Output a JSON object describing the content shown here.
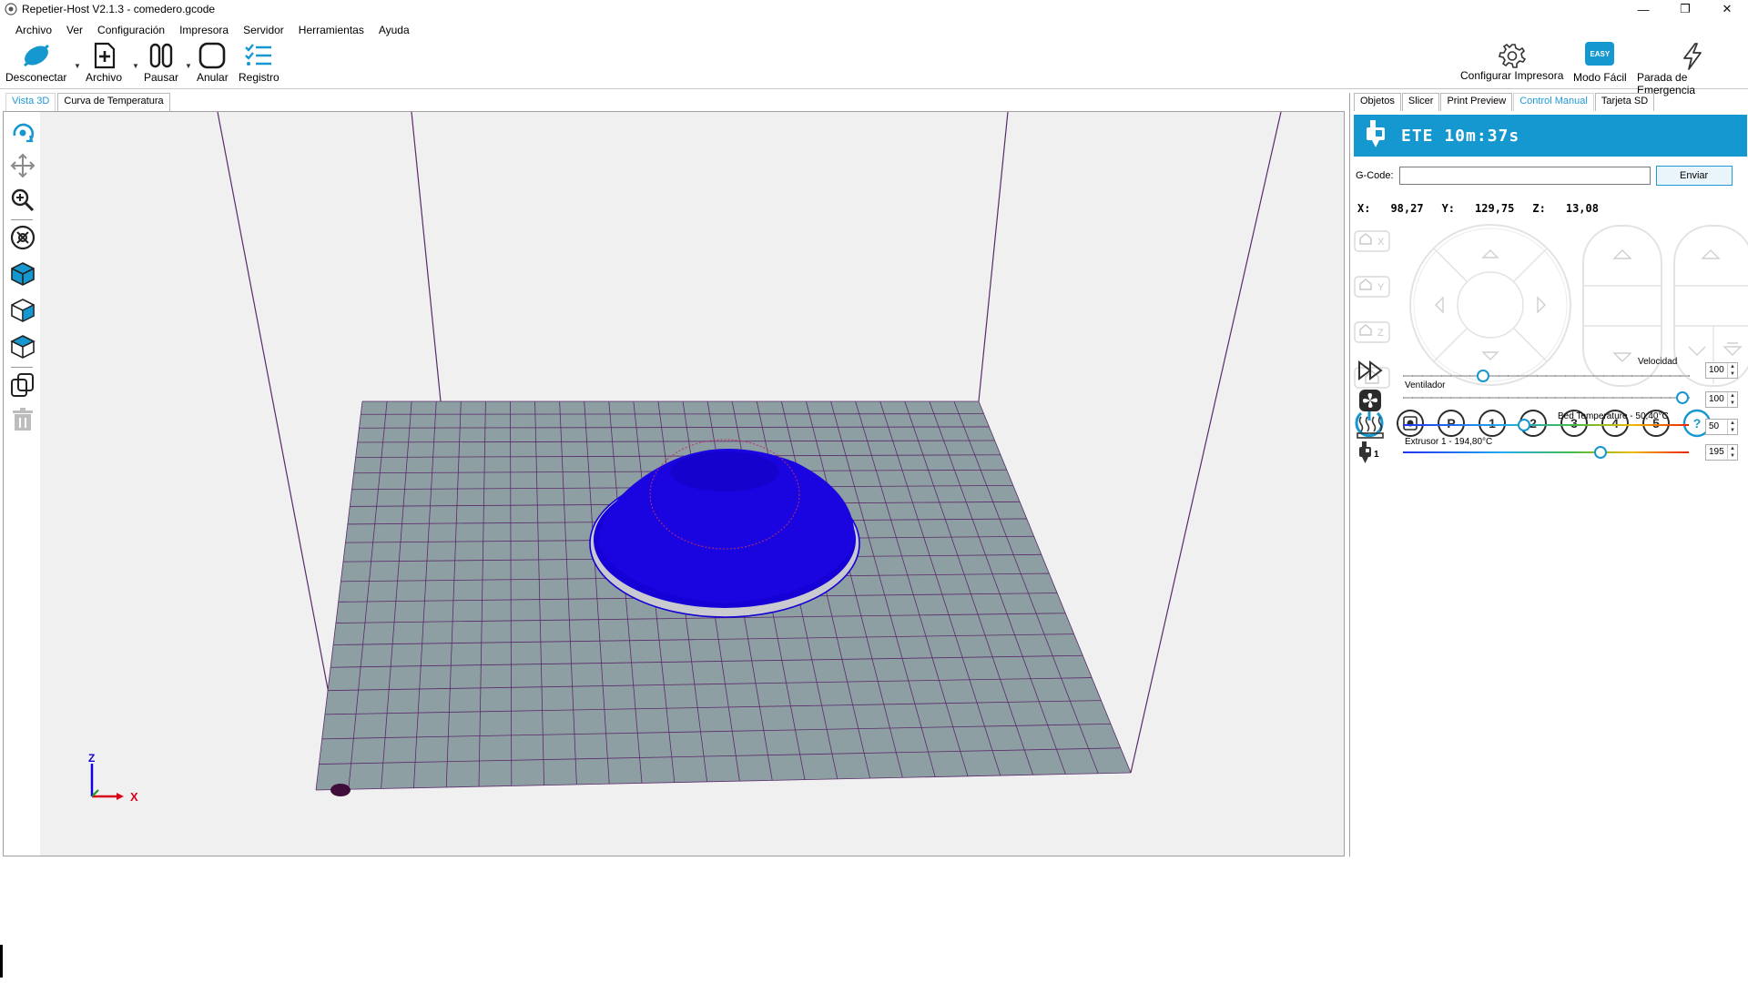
{
  "window": {
    "title": "Repetier-Host V2.1.3 - comedero.gcode",
    "controls": [
      "—",
      "❐",
      "✕"
    ]
  },
  "menu": [
    "Archivo",
    "Ver",
    "Configuración",
    "Impresora",
    "Servidor",
    "Herramientas",
    "Ayuda"
  ],
  "toolbar": {
    "disconnect": "Desconectar",
    "file": "Archivo",
    "pause": "Pausar",
    "cancel": "Anular",
    "log": "Registro",
    "configure_printer": "Configurar Impresora",
    "easy_mode": "Modo Fácil",
    "easy_badge": "EASY",
    "emergency_stop": "Parada de Emergencia"
  },
  "left_tabs": [
    "Vista 3D",
    "Curva de Temperatura"
  ],
  "left_tabs_active": 0,
  "sidetools": [
    "rotate-icon",
    "move-icon",
    "zoom-icon",
    "fit-view-icon",
    "iso-view-icon",
    "front-view-icon",
    "top-view-icon",
    "copy-object-icon",
    "trash-icon"
  ],
  "axes": {
    "z": "Z",
    "x": "X"
  },
  "right_tabs": [
    "Objetos",
    "Slicer",
    "Print Preview",
    "Control Manual",
    "Tarjeta SD"
  ],
  "right_tabs_active": 3,
  "manual": {
    "ete": "ETE 10m:37s",
    "gcode_label": "G-Code:",
    "gcode_value": "",
    "send": "Enviar",
    "x_label": "X:",
    "x_value": "98,27",
    "y_label": "Y:",
    "y_value": "129,75",
    "z_label": "Z:",
    "z_value": "13,08",
    "home_labels": [
      "X",
      "Y",
      "Z",
      ""
    ],
    "buttons": [
      "P",
      "1",
      "2",
      "3",
      "4",
      "5",
      "?"
    ],
    "speed_label": "Velocidad",
    "speed_value": "100",
    "speed_fraction": 0.27,
    "fan_label": "Ventilador",
    "fan_value": "100",
    "fan_fraction": 1.0,
    "bed_label": "Bed Temperature - 50,40°C",
    "bed_value": "50",
    "bed_fraction": 0.42,
    "extruder_label": "Extrusor 1 - 194,80°C",
    "extruder_value": "195",
    "extruder_fraction": 0.7,
    "extruder_num": "1"
  },
  "colors": {
    "accent": "#1597cf",
    "bed": "#8e9fa3",
    "model": "#1500d6",
    "frame": "#5a2a6b"
  }
}
